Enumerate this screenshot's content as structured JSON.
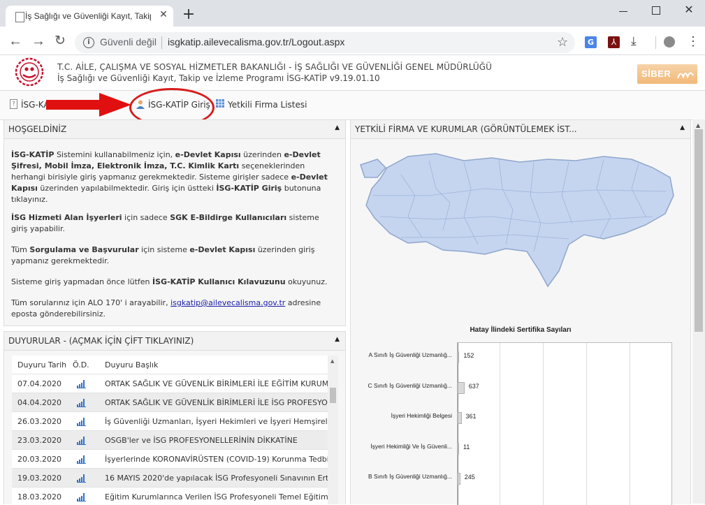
{
  "browser": {
    "tab_title": "İş Sağlığı ve Güvenliği Kayıt, Takip",
    "security_label": "Güvenli değil",
    "url": "isgkatip.ailevecalisma.gov.tr/Logout.aspx"
  },
  "header": {
    "line1": "T.C. AİLE, ÇALIŞMA VE SOSYAL HİZMETLER BAKANLIĞI - İŞ SAĞLIĞI VE GÜVENLİĞİ GENEL MÜDÜRLÜĞÜ",
    "line2": "İş Sağlığı ve Güvenliği Kayıt, Takip ve İzleme Programı İSG-KATİP v9.19.01.10",
    "siber_logo_text": "SİBER"
  },
  "menu": {
    "item1": "İSG-KA",
    "login": "İSG-KATİP Giriş",
    "firm_list": "Yetkili Firma Listesi"
  },
  "welcome": {
    "title": "HOŞGELDİNİZ",
    "p1": {
      "a": "İSG-KATİP",
      "b": " Sistemini kullanabilmeniz için, ",
      "c": "e-Devlet Kapısı",
      "d": " üzerinden ",
      "e": "e-Devlet Şifresi, Mobil İmza, Elektronik İmza, T.C. Kimlik Kartı",
      "f": " seçeneklerinden herhangi birisiyle giriş yapmanız gerekmektedir. Sisteme girişler sadece ",
      "g": "e-Devlet Kapısı",
      "h": " üzerinden yapılabilmektedir. Giriş için üstteki ",
      "i": "İSG-KATİP Giriş",
      "j": " butonuna tıklayınız."
    },
    "p2": {
      "a": "İSG Hizmeti Alan İşyerleri",
      "b": " için sadece ",
      "c": "SGK E-Bildirge Kullanıcıları",
      "d": " sisteme giriş yapabilir."
    },
    "p3": {
      "a": "Tüm ",
      "b": "Sorgulama ve Başvurular",
      "c": " için sisteme ",
      "d": "e-Devlet Kapısı",
      "e": " üzerinden giriş yapmanız gerekmektedir."
    },
    "p4": {
      "a": "Sisteme giriş yapmadan önce lütfen ",
      "b": "İSG-KATİP Kullanıcı Kılavuzunu",
      "c": " okuyunuz."
    },
    "p5": {
      "a": "Tüm sorularınız için ALO 170' i arayabilir, ",
      "link": "isgkatip@ailevecalisma.gov.tr",
      "c": " adresine eposta gönderebilirsiniz."
    }
  },
  "announcements": {
    "title": "DUYURULAR - (AÇMAK İÇİN ÇİFT TIKLAYINIZ)",
    "col_date": "Duyuru Tarih",
    "col_od": "Ö.D.",
    "col_title": "Duyuru Başlık",
    "rows": [
      {
        "date": "07.04.2020",
        "title": "ORTAK SAĞLIK VE GÜVENLİK BİRİMLERİ İLE EĞİTİM KURUMLARI"
      },
      {
        "date": "04.04.2020",
        "title": "ORTAK SAĞLIK VE GÜVENLİK BİRİMLERİ İLE İSG PROFESYONELLERİ"
      },
      {
        "date": "26.03.2020",
        "title": "İş Güvenliği Uzmanları, İşyeri Hekimleri ve İşyeri Hemşirelerinin"
      },
      {
        "date": "23.03.2020",
        "title": "OSGB'ler ve İSG PROFESYONELLERİNİN DİKKATİNE"
      },
      {
        "date": "20.03.2020",
        "title": "İşyerlerinde KORONAVİRÜSTEN (COVID-19) Korunma Tedbirleri"
      },
      {
        "date": "19.03.2020",
        "title": "16 MAYIS 2020'de yapılacak İSG Profesyoneli Sınavının Ertelenmesi"
      },
      {
        "date": "18.03.2020",
        "title": "Eğitim Kurumlarınca Verilen İSG Profesyoneli Temel Eğitim Programları"
      }
    ]
  },
  "firms": {
    "title": "YETKİLİ FİRMA VE KURUMLAR (GÖRÜNTÜLEMEK İST..."
  },
  "chart_data": {
    "type": "bar",
    "title": "Hatay İlindeki Sertifika Sayıları",
    "orientation": "horizontal",
    "categories": [
      "A Sınıfı İş Güvenliği Uzmanlığ...",
      "C Sınıfı İş Güvenliği Uzmanlığ...",
      "İşyeri Hekimliği Belgesi",
      "İşyeri Hekimliği Ve İş Güvenli...",
      "B Sınıfı İş Güvenliği Uzmanlığ..."
    ],
    "values": [
      152,
      637,
      361,
      11,
      245
    ],
    "xlim": [
      0,
      20000
    ],
    "grid": true
  },
  "colors": {
    "accent_red": "#d0201e",
    "bar_fill": "#d9d9d9",
    "map_fill": "#c5d5f0",
    "map_stroke": "#8fa6cc"
  }
}
